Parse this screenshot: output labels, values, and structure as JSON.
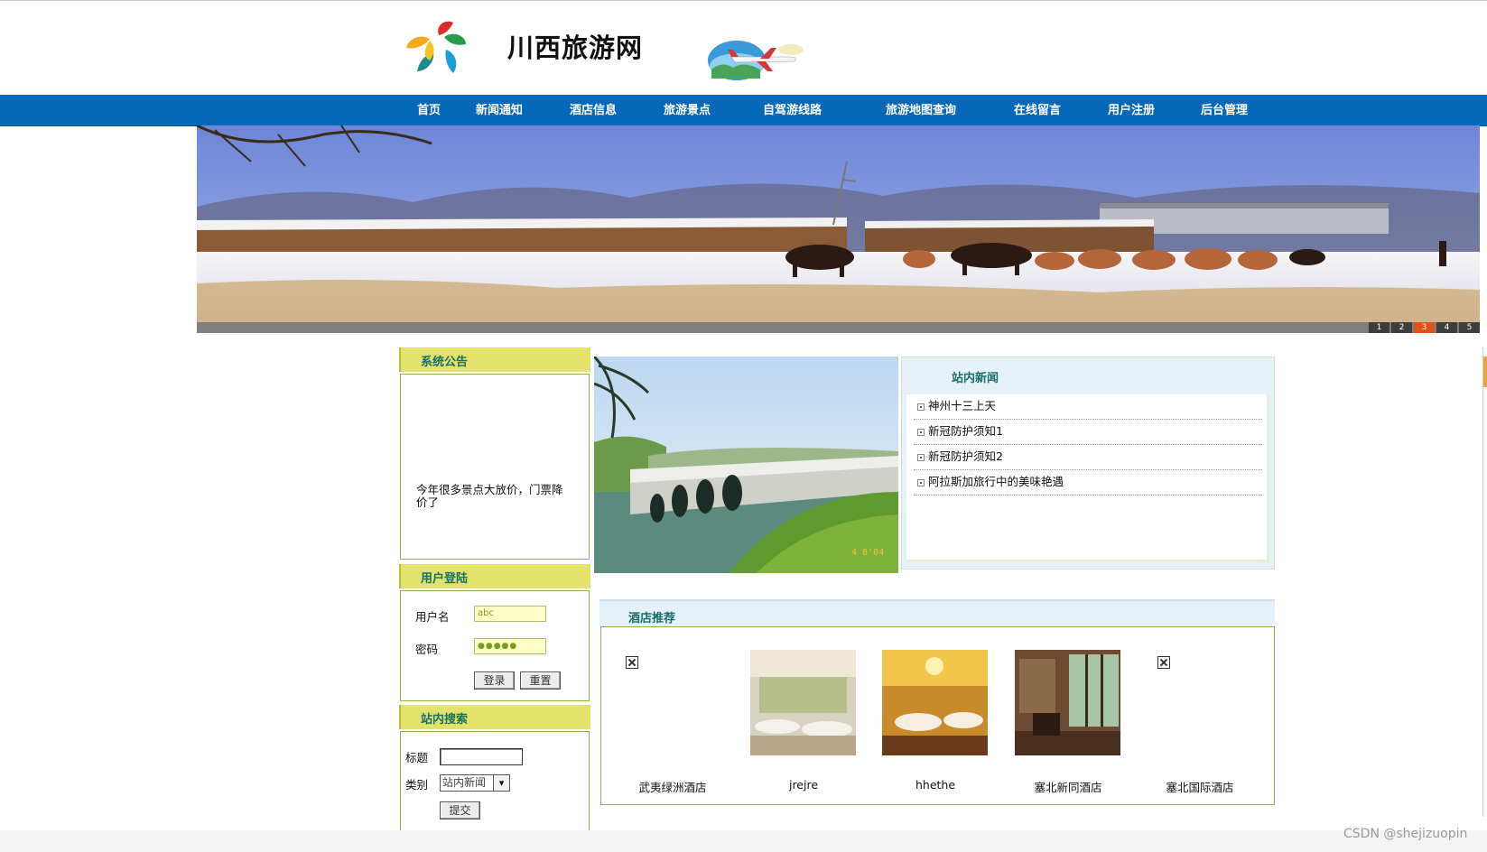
{
  "header": {
    "site_title": "川西旅游网"
  },
  "nav": {
    "items": [
      "首页",
      "新闻通知",
      "酒店信息",
      "旅游景点",
      "自驾游线路",
      "旅游地图查询",
      "在线留言",
      "用户注册",
      "后台管理"
    ]
  },
  "banner": {
    "pages": [
      "1",
      "2",
      "3",
      "4",
      "5"
    ],
    "active_page": "3"
  },
  "notice": {
    "title": "系统公告",
    "text": "今年很多景点大放价，门票降价了"
  },
  "login": {
    "title": "用户登陆",
    "username_label": "用户名",
    "username_value": "abc",
    "password_label": "密码",
    "password_value": "●●●●●",
    "login_button": "登录",
    "reset_button": "重置"
  },
  "search": {
    "title": "站内搜索",
    "title_label": "标题",
    "category_label": "类别",
    "category_selected": "站内新闻",
    "submit_button": "提交"
  },
  "news": {
    "title": "站内新闻",
    "items": [
      "神州十三上天",
      "新冠防护须知1",
      "新冠防护须知2",
      "阿拉斯加旅行中的美味艳遇"
    ]
  },
  "hotels": {
    "title": "酒店推荐",
    "items": [
      {
        "name": "武夷绿洲酒店",
        "image": "broken"
      },
      {
        "name": "jrejre",
        "image": "banquet-hall-white"
      },
      {
        "name": "hhethe",
        "image": "banquet-hall-gold"
      },
      {
        "name": "塞北新同酒店",
        "image": "restaurant-interior"
      },
      {
        "name": "塞北国际酒店",
        "image": "broken"
      }
    ]
  },
  "watermark": "CSDN @shejizuopin",
  "colors": {
    "nav_bg": "#0568b8",
    "panel_head": "#e3e26a",
    "panel_title": "#176f6a",
    "border_green": "#8bb24f",
    "pager_active": "#e0521c"
  }
}
